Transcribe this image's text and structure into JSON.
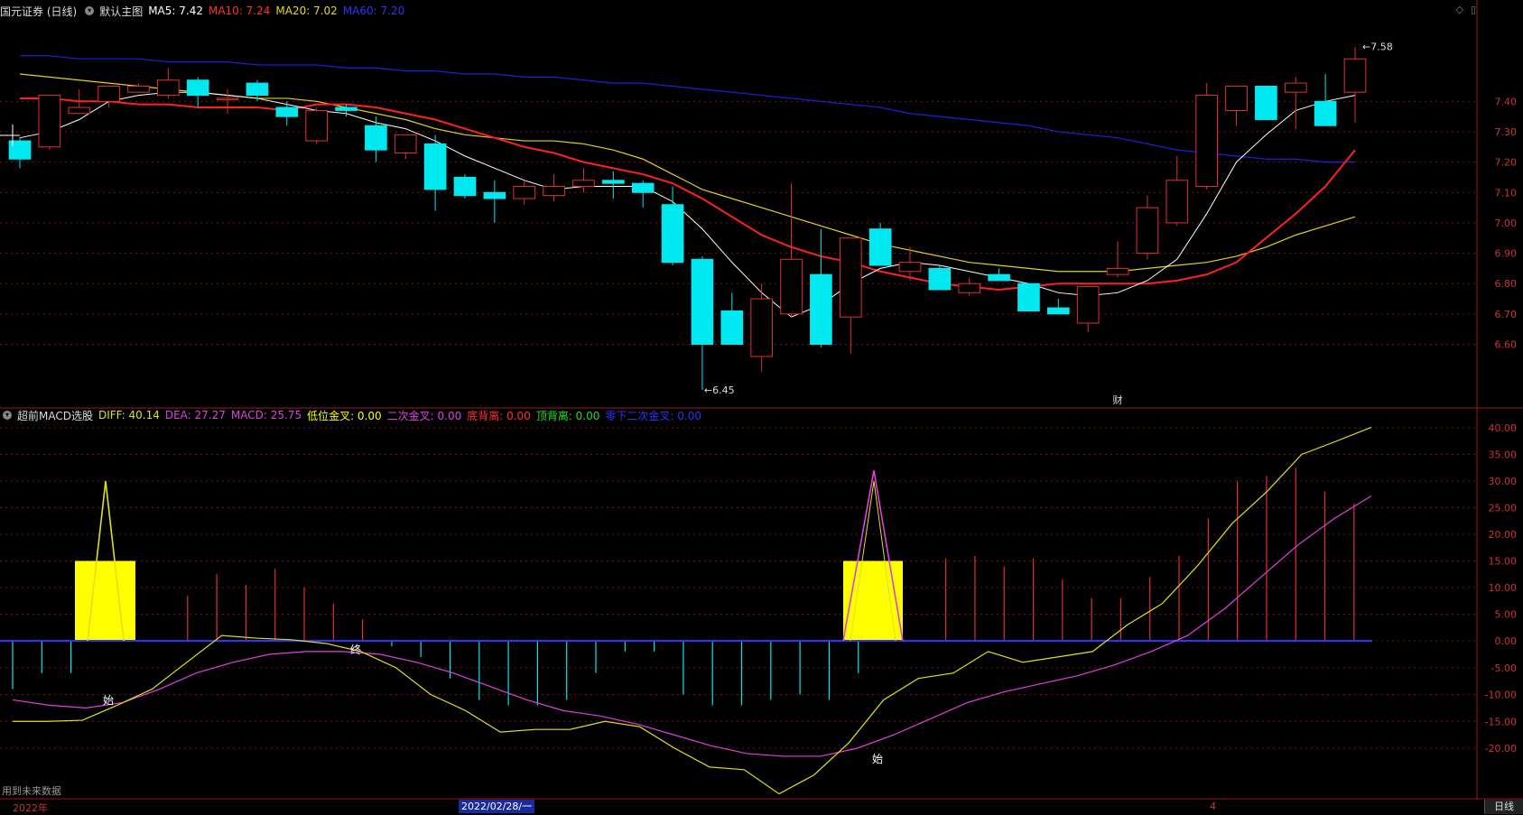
{
  "main_header": {
    "stock_title": "国元证券 (日线)",
    "template_label": "默认主图",
    "ma5": "MA5: 7.42",
    "ma10": "MA10: 7.24",
    "ma20": "MA20: 7.02",
    "ma60": "MA60: 7.20"
  },
  "sub_header": {
    "indicator_name": "超前MACD选股",
    "diff": "DIFF: 40.14",
    "dea": "DEA: 27.27",
    "macd": "MACD: 25.75",
    "low_cross": "低位金叉: 0.00",
    "second_cross": "二次金叉: 0.00",
    "bottom_div": "底背离: 0.00",
    "top_div": "顶背离: 0.00",
    "below_zero_second": "零下二次金叉: 0.00"
  },
  "colors": {
    "ma5": "#ffffff",
    "ma10": "#ff2020",
    "ma20": "#e0d020",
    "ma60": "#2020e0",
    "up": "#e03030",
    "down": "#00e8f0",
    "diff": "#e0e020",
    "dea": "#e040e0",
    "grid": "#7a1010",
    "signal": "#ffff00"
  },
  "chart_data": [
    {
      "type": "candlestick",
      "title": "国元证券 (日线)",
      "ylim": [
        6.45,
        7.6
      ],
      "y_ticks": [
        "7.40",
        "7.30",
        "7.20",
        "7.10",
        "7.00",
        "6.90",
        "6.80",
        "6.70",
        "6.60"
      ],
      "annotations": {
        "high": "7.58",
        "low": "6.45",
        "event": "财"
      },
      "candles": [
        [
          7.27,
          7.28,
          7.18,
          7.21
        ],
        [
          7.25,
          7.42,
          7.24,
          7.42
        ],
        [
          7.36,
          7.44,
          7.36,
          7.38
        ],
        [
          7.4,
          7.45,
          7.38,
          7.45
        ],
        [
          7.43,
          7.46,
          7.43,
          7.45
        ],
        [
          7.42,
          7.51,
          7.41,
          7.47
        ],
        [
          7.47,
          7.48,
          7.38,
          7.42
        ],
        [
          7.41,
          7.44,
          7.36,
          7.41
        ],
        [
          7.46,
          7.47,
          7.4,
          7.42
        ],
        [
          7.38,
          7.4,
          7.32,
          7.35
        ],
        [
          7.27,
          7.38,
          7.26,
          7.37
        ],
        [
          7.38,
          7.39,
          7.35,
          7.37
        ],
        [
          7.32,
          7.35,
          7.2,
          7.24
        ],
        [
          7.23,
          7.29,
          7.21,
          7.29
        ],
        [
          7.26,
          7.29,
          7.04,
          7.11
        ],
        [
          7.15,
          7.16,
          7.08,
          7.09
        ],
        [
          7.1,
          7.14,
          7.0,
          7.08
        ],
        [
          7.08,
          7.14,
          7.06,
          7.12
        ],
        [
          7.09,
          7.16,
          7.07,
          7.12
        ],
        [
          7.12,
          7.18,
          7.1,
          7.14
        ],
        [
          7.14,
          7.17,
          7.08,
          7.13
        ],
        [
          7.13,
          7.14,
          7.05,
          7.1
        ],
        [
          7.06,
          7.12,
          6.86,
          6.87
        ],
        [
          6.88,
          6.89,
          6.45,
          6.6
        ],
        [
          6.71,
          6.77,
          6.6,
          6.6
        ],
        [
          6.56,
          6.8,
          6.51,
          6.75
        ],
        [
          6.7,
          7.13,
          6.69,
          6.88
        ],
        [
          6.83,
          6.98,
          6.59,
          6.6
        ],
        [
          6.69,
          6.93,
          6.57,
          6.95
        ],
        [
          6.98,
          7.0,
          6.86,
          6.86
        ],
        [
          6.84,
          6.92,
          6.81,
          6.87
        ],
        [
          6.85,
          6.86,
          6.78,
          6.78
        ],
        [
          6.77,
          6.82,
          6.76,
          6.8
        ],
        [
          6.83,
          6.85,
          6.81,
          6.81
        ],
        [
          6.8,
          6.8,
          6.71,
          6.71
        ],
        [
          6.72,
          6.75,
          6.7,
          6.7
        ],
        [
          6.67,
          6.79,
          6.64,
          6.79
        ],
        [
          6.83,
          6.94,
          6.82,
          6.85
        ],
        [
          6.9,
          7.09,
          6.88,
          7.05
        ],
        [
          7.0,
          7.22,
          6.99,
          7.14
        ],
        [
          7.12,
          7.46,
          7.11,
          7.42
        ],
        [
          7.37,
          7.45,
          7.32,
          7.45
        ],
        [
          7.45,
          7.45,
          7.34,
          7.34
        ],
        [
          7.43,
          7.48,
          7.31,
          7.46
        ],
        [
          7.4,
          7.49,
          7.32,
          7.32
        ],
        [
          7.43,
          7.58,
          7.33,
          7.54
        ]
      ],
      "ma5": [
        7.28,
        7.3,
        7.34,
        7.4,
        7.42,
        7.43,
        7.43,
        7.42,
        7.41,
        7.39,
        7.37,
        7.36,
        7.33,
        7.31,
        7.27,
        7.22,
        7.18,
        7.14,
        7.11,
        7.12,
        7.12,
        7.12,
        7.07,
        6.98,
        6.87,
        6.77,
        6.69,
        6.73,
        6.8,
        6.85,
        6.87,
        6.86,
        6.84,
        6.82,
        6.8,
        6.77,
        6.76,
        6.77,
        6.81,
        6.88,
        7.03,
        7.2,
        7.29,
        7.37,
        7.4,
        7.42
      ],
      "ma10": [
        7.41,
        7.41,
        7.4,
        7.4,
        7.39,
        7.39,
        7.38,
        7.38,
        7.38,
        7.37,
        7.39,
        7.39,
        7.38,
        7.36,
        7.34,
        7.31,
        7.28,
        7.25,
        7.23,
        7.2,
        7.18,
        7.16,
        7.13,
        7.08,
        7.02,
        6.96,
        6.92,
        6.89,
        6.87,
        6.84,
        6.82,
        6.8,
        6.79,
        6.78,
        6.79,
        6.8,
        6.8,
        6.8,
        6.8,
        6.81,
        6.83,
        6.87,
        6.95,
        7.03,
        7.12,
        7.24
      ],
      "ma20": [
        7.49,
        7.48,
        7.47,
        7.46,
        7.45,
        7.44,
        7.43,
        7.42,
        7.41,
        7.41,
        7.4,
        7.38,
        7.36,
        7.34,
        7.31,
        7.29,
        7.28,
        7.27,
        7.27,
        7.26,
        7.24,
        7.21,
        7.16,
        7.11,
        7.08,
        7.05,
        7.02,
        6.99,
        6.96,
        6.93,
        6.91,
        6.89,
        6.87,
        6.86,
        6.85,
        6.84,
        6.84,
        6.84,
        6.85,
        6.86,
        6.87,
        6.89,
        6.92,
        6.96,
        6.99,
        7.02
      ],
      "ma60": [
        7.55,
        7.55,
        7.54,
        7.54,
        7.54,
        7.53,
        7.53,
        7.53,
        7.52,
        7.52,
        7.52,
        7.51,
        7.51,
        7.5,
        7.5,
        7.49,
        7.49,
        7.48,
        7.48,
        7.47,
        7.46,
        7.46,
        7.45,
        7.44,
        7.43,
        7.42,
        7.41,
        7.4,
        7.39,
        7.38,
        7.36,
        7.35,
        7.34,
        7.33,
        7.32,
        7.3,
        7.29,
        7.28,
        7.26,
        7.24,
        7.23,
        7.22,
        7.21,
        7.21,
        7.2,
        7.2
      ]
    },
    {
      "type": "macd",
      "title": "超前MACD选股",
      "ylim": [
        -28,
        42
      ],
      "y_ticks": [
        "40.00",
        "35.00",
        "30.00",
        "25.00",
        "20.00",
        "15.00",
        "10.00",
        "5.00",
        "0.00",
        "-5.00",
        "-10.00",
        "-15.00",
        "-20.00"
      ],
      "diff": [
        -15,
        -15,
        -14.8,
        -12,
        -9,
        -4,
        1,
        0.5,
        0.2,
        -0.5,
        -2,
        -5,
        -10,
        -13,
        -17,
        -16.5,
        -16.5,
        -15,
        -16,
        -20,
        -23.5,
        -24,
        -28.5,
        -25,
        -19,
        -11,
        -7,
        -6,
        -2,
        -4,
        -3,
        -2,
        3,
        7,
        14,
        22,
        28,
        35,
        37.5,
        40.1
      ],
      "dea": [
        -11,
        -12,
        -12.5,
        -11.5,
        -9,
        -6,
        -4,
        -2.5,
        -2,
        -2,
        -2.5,
        -4,
        -6,
        -8.5,
        -11,
        -13,
        -14,
        -15.5,
        -17.5,
        -19.5,
        -21,
        -21.5,
        -21.5,
        -20,
        -17.5,
        -14.5,
        -11.5,
        -9.5,
        -8,
        -6.5,
        -4.5,
        -2,
        1,
        6,
        12,
        18,
        23,
        27.2
      ],
      "macd": [
        -9,
        -6,
        -6,
        0,
        0,
        0,
        8.5,
        12.5,
        10.5,
        13.5,
        10,
        7,
        4,
        -1,
        -3,
        -7,
        -11,
        -12,
        -12,
        -11,
        -6,
        -2,
        -2,
        -10,
        -12,
        -12,
        -11,
        -10,
        -11,
        -6,
        0,
        0,
        15.5,
        16,
        14,
        15.5,
        11.5,
        8,
        8,
        12,
        16,
        23,
        30,
        31,
        32.5,
        28,
        25.8
      ],
      "signal_blocks": [
        {
          "start": 2,
          "end": 3,
          "height": 15
        },
        {
          "start": 27,
          "end": 28,
          "height": 15
        }
      ],
      "spikes": [
        {
          "index": 3,
          "value": 30,
          "color": "yellow"
        },
        {
          "index": 28,
          "value": 32,
          "color": "magenta"
        }
      ],
      "labels": [
        {
          "text": "始",
          "at": 3
        },
        {
          "text": "终",
          "at": 11
        },
        {
          "text": "始",
          "at": 28
        }
      ]
    }
  ],
  "footer": {
    "date_start": "2022年",
    "cursor_date": "2022/02/28/一",
    "month_marker": "4",
    "period": "日线",
    "future_note": "用到未来数据"
  }
}
